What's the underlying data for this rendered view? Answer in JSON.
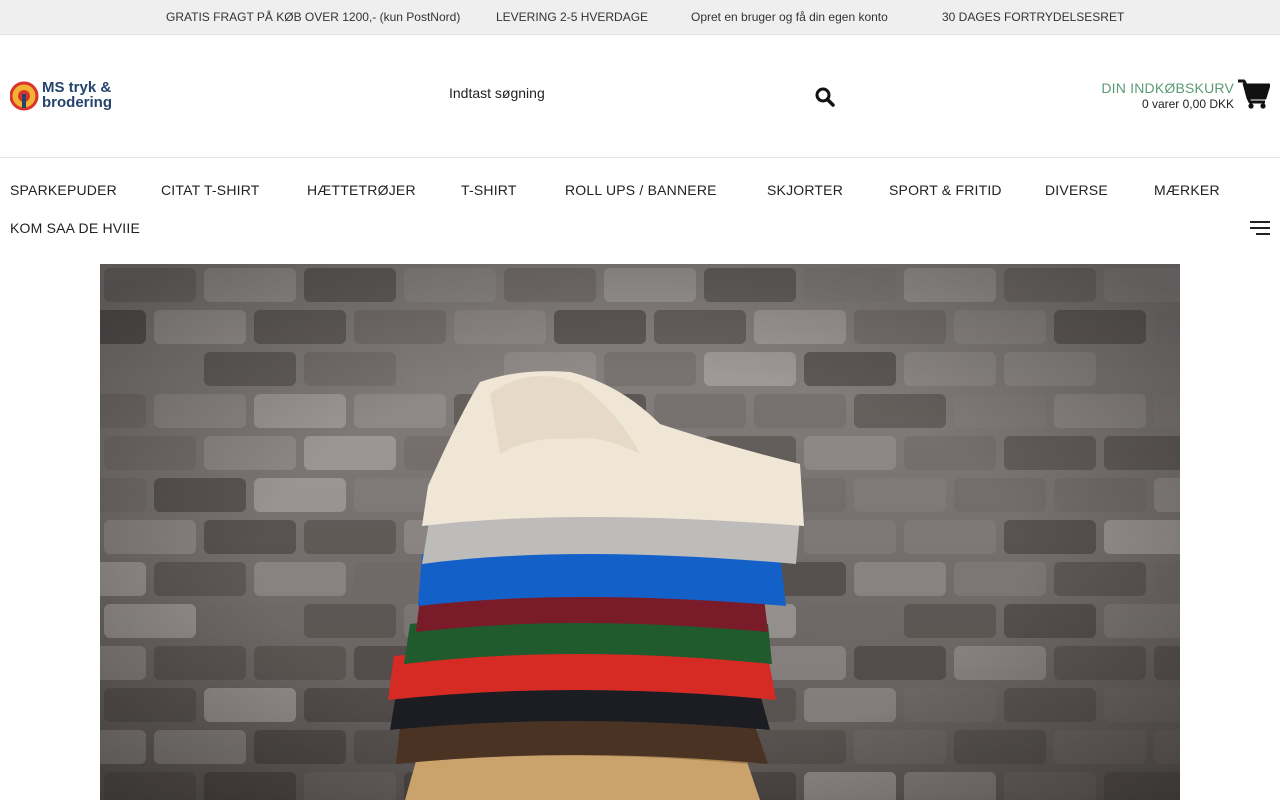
{
  "topbar": {
    "messages": [
      "GRATIS FRAGT PÅ KØB OVER 1200,- (kun PostNord)",
      "LEVERING 2-5 HVERDAGE",
      "Opret en bruger og få din egen konto",
      "30 DAGES FORTRYDELSESRET"
    ]
  },
  "header": {
    "logo_text": "MS tryk & brodering",
    "search": {
      "placeholder": "Indtast søgning",
      "icon": "search-icon"
    },
    "cart": {
      "title": "DIN INDKØBSKURV",
      "summary": "0 varer 0,00 DKK",
      "icon": "cart-icon"
    }
  },
  "nav": {
    "items": [
      "SPARKEPUDER",
      "CITAT T-SHIRT",
      "HÆTTETRØJER",
      "T-SHIRT",
      "ROLL UPS / BANNERE",
      "SKJORTER",
      "SPORT & FRITID",
      "DIVERSE",
      "MÆRKER",
      "KOM SAA DE HVIIE"
    ],
    "menu_icon": "hamburger-menu-icon"
  },
  "hero": {
    "image": "stack of folded hoodies on wooden stool in front of brick wall"
  },
  "colors": {
    "accent": "#5a9a78",
    "topbar_bg": "#efefef",
    "logo_blue": "#24446e",
    "logo_red": "#d9342b"
  }
}
